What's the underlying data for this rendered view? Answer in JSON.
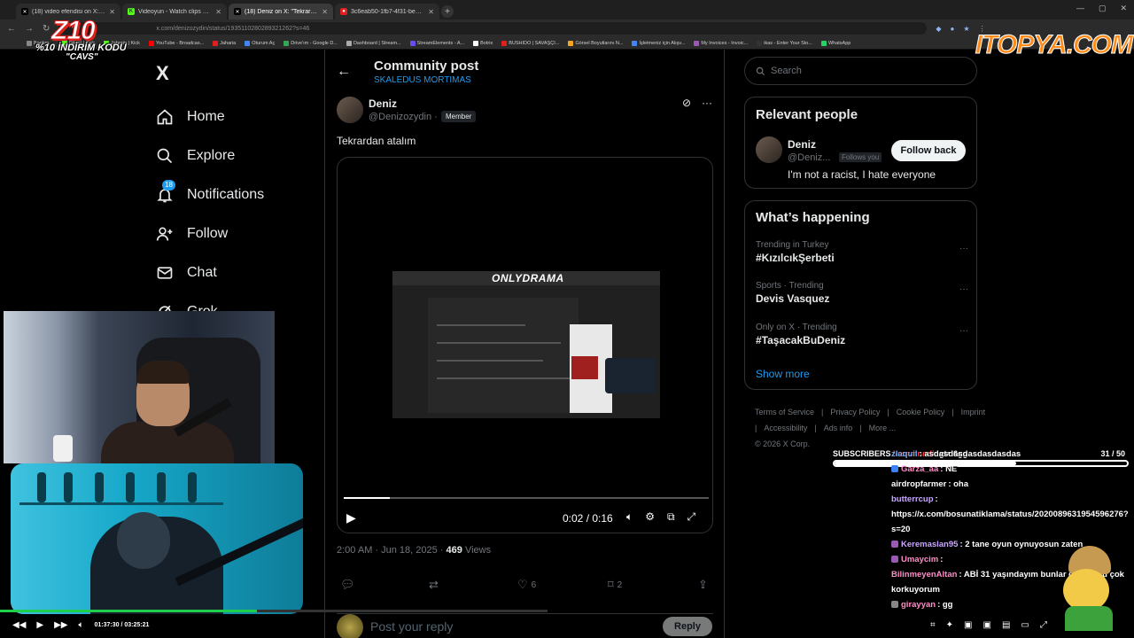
{
  "browser": {
    "tabs": [
      {
        "title": "(18) video efendisi on X: \"Bilal",
        "color": "#000000",
        "icon": "x-icon",
        "active": false
      },
      {
        "title": "Videoyun - Watch clips on Kick",
        "color": "#53fc18",
        "icon": "kick-icon",
        "active": false
      },
      {
        "title": "(18) Deniz on X: \"Tekrardan atal",
        "color": "#000000",
        "icon": "x-icon",
        "active": true
      },
      {
        "title": "3c6eab50-1fb7-4f31-be88-82",
        "color": "#e0201f",
        "icon": "globe-icon",
        "active": false
      }
    ],
    "new_tab": "+",
    "url": "x.com/denizozydin/status/1935110280289321262?s=46",
    "bookmarks": [
      {
        "label": "Bookm...",
        "color": "#888888"
      },
      {
        "label": "Gitost | Kick",
        "color": "#53fc18"
      },
      {
        "label": "Jahrein | Kick",
        "color": "#53fc18"
      },
      {
        "label": "YouTube - Broadcas...",
        "color": "#ff0000"
      },
      {
        "label": "Jaharia",
        "color": "#e0201f"
      },
      {
        "label": "Oturum Aç",
        "color": "#4285f4"
      },
      {
        "label": "Drive'ım - Google D...",
        "color": "#34a853"
      },
      {
        "label": "Dashboard | Stream...",
        "color": "#aaaaaa"
      },
      {
        "label": "StreamElements - A...",
        "color": "#6a4cf0"
      },
      {
        "label": "Botrix",
        "color": "#ffffff"
      },
      {
        "label": "BUSHIDO | SAVAŞÇI...",
        "color": "#e0201f"
      },
      {
        "label": "Görsel Boyutlarını N...",
        "color": "#f5a623"
      },
      {
        "label": "İşletmeniz için Alışv...",
        "color": "#4285f4"
      },
      {
        "label": "My Invoices - Invoic...",
        "color": "#9b59b6"
      },
      {
        "label": "ikas - Enter Your Sto...",
        "color": "#333333"
      },
      {
        "label": "WhatsApp",
        "color": "#25d366"
      }
    ]
  },
  "overlay": {
    "promo_big": "Z10",
    "promo_line1": "%10 İNDİRİM KODU",
    "promo_line2": "\"CAVS\"",
    "brand": "ITOPYA.COM"
  },
  "sidebar": {
    "logo": "X",
    "items": [
      {
        "label": "Home",
        "icon": "home-icon"
      },
      {
        "label": "Explore",
        "icon": "search-icon"
      },
      {
        "label": "Notifications",
        "icon": "bell-icon",
        "badge": "18"
      },
      {
        "label": "Follow",
        "icon": "follow-icon"
      },
      {
        "label": "Chat",
        "icon": "mail-icon"
      },
      {
        "label": "Grok",
        "icon": "grok-icon"
      }
    ]
  },
  "header": {
    "title": "Community post",
    "subtitle": "SKALEDUS MORTIMAS"
  },
  "post": {
    "name": "Deniz",
    "handle": "@Denizozydin",
    "separator": "·",
    "member": "Member",
    "text": "Tekrardan atalım",
    "video": {
      "thumb_title": "ONLYDRAMA",
      "time": "0:02 / 0:16",
      "progress": 0.125
    },
    "timestamp": "2:00 AM · Jun 18, 2025 ·",
    "views": "469",
    "views_label": "Views",
    "likes": "6",
    "bookmarks": "2",
    "reply_placeholder": "Post your reply",
    "reply_button": "Reply"
  },
  "right": {
    "search_placeholder": "Search",
    "relevant_title": "Relevant people",
    "relevant": {
      "name": "Deniz",
      "handle": "@Deniz...",
      "follows_you": "Follows you",
      "follow_button": "Follow back",
      "bio": "I'm not a racist, I hate everyone"
    },
    "happening_title": "What’s happening",
    "trends": [
      {
        "context": "Trending in Turkey",
        "title": "#KızılcıkŞerbeti"
      },
      {
        "context": "Sports · Trending",
        "title": "Devis Vasquez"
      },
      {
        "context": "Only on X · Trending",
        "title": "#TaşacakBuDeniz"
      }
    ],
    "show_more": "Show more",
    "footer": [
      "Terms of Service",
      "|",
      "Privacy Policy",
      "|",
      "Cookie Policy",
      "|",
      "Imprint",
      "|",
      "Accessibility",
      "|",
      "Ads info",
      "|",
      "More ...",
      "© 2026 X Corp."
    ]
  },
  "stream": {
    "subscribers_label": "SUBSCRIBERS",
    "sub_user": "lexsvanndi",
    "sub_msg": ": gta 6gg",
    "subs_count": "31 / 50",
    "subs_progress": 0.62,
    "player_time": "01:37:30 / 03:25:21",
    "player_progress": 0.47,
    "chat": [
      {
        "user": "zlaquil",
        "msg": ": asdasdasdasdasdasdas",
        "color": "#6fb3ff",
        "tag": ""
      },
      {
        "user": "Garza_aa",
        "msg": ": NE",
        "color": "#ff8dc7",
        "tag": "#3b82f6"
      },
      {
        "user": "airdropfarmer",
        "msg": ": oha",
        "color": "#ffffff",
        "tag": ""
      },
      {
        "user": "butterrcup",
        "msg": ": https://x.com/bosunatiklama/status/2020089631954596276?s=20",
        "color": "#c9a7ff",
        "tag": ""
      },
      {
        "user": "Keremaslan95",
        "msg": ": 2 tane oyun oynuyosun zaten",
        "color": "#c9a7ff",
        "tag": "#9b59b6"
      },
      {
        "user": "Umaycim",
        "msg": ":",
        "color": "#ff8dc7",
        "tag": "#9b59b6"
      },
      {
        "user": "BilinmeyenAltan",
        "msg": ": ABİ 31 yaşındayım bunlar doğru mu çok korkuyorum",
        "color": "#ff8dc7",
        "tag": ""
      },
      {
        "user": "girayyan",
        "msg": ": gg",
        "color": "#ff8dc7",
        "tag": "#888888"
      }
    ]
  }
}
